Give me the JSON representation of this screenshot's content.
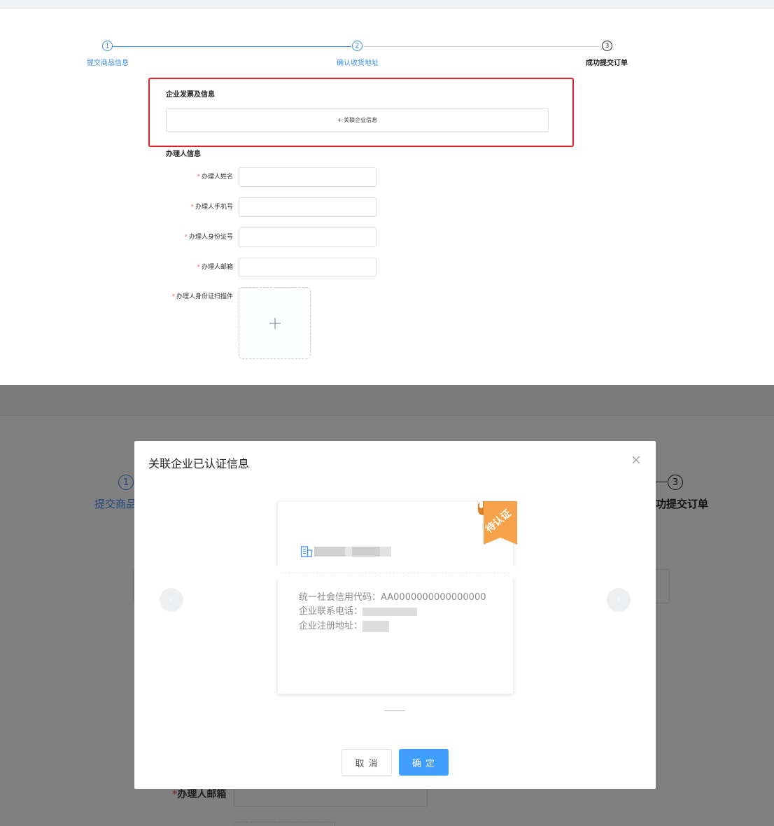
{
  "top": {
    "steps": [
      {
        "num": "1",
        "label": "提交商品信息"
      },
      {
        "num": "2",
        "label": "确认收货地址"
      },
      {
        "num": "3",
        "label": "成功提交订单"
      }
    ],
    "invoice_section_title": "企业发票及信息",
    "link_company_button": "+ 关联企业信息",
    "handler_section_title": "办理人信息",
    "fields": [
      {
        "label": "办理人姓名"
      },
      {
        "label": "办理人手机号"
      },
      {
        "label": "办理人身份证号"
      },
      {
        "label": "办理人邮箱"
      }
    ],
    "upload_label": "办理人身份证扫描件",
    "required_mark": "*"
  },
  "bottom": {
    "bg_steps": [
      {
        "num": "1",
        "label": "提交商品"
      },
      {
        "num": "3",
        "label": "功提交订单"
      }
    ],
    "bg_email_label": "办理人邮箱",
    "modal": {
      "title": "关联企业已认证信息",
      "badge": "待认证",
      "credit_code_label": "统一社会信用代码：",
      "credit_code_value": "AA0000000000000000",
      "phone_label": "企业联系电话：",
      "address_label": "企业注册地址：",
      "cancel_label": "取 消",
      "ok_label": "确 定"
    }
  },
  "colors": {
    "primary": "#409eff",
    "step_blue": "#3a8ee6",
    "highlight_red": "#e8202a",
    "badge_orange": "#f5a24a",
    "required_red": "#f56c6c"
  },
  "icons": {
    "close": "close-icon",
    "prev": "chevron-left-icon",
    "next": "chevron-right-icon",
    "company": "building-icon",
    "upload": "plus-icon"
  }
}
